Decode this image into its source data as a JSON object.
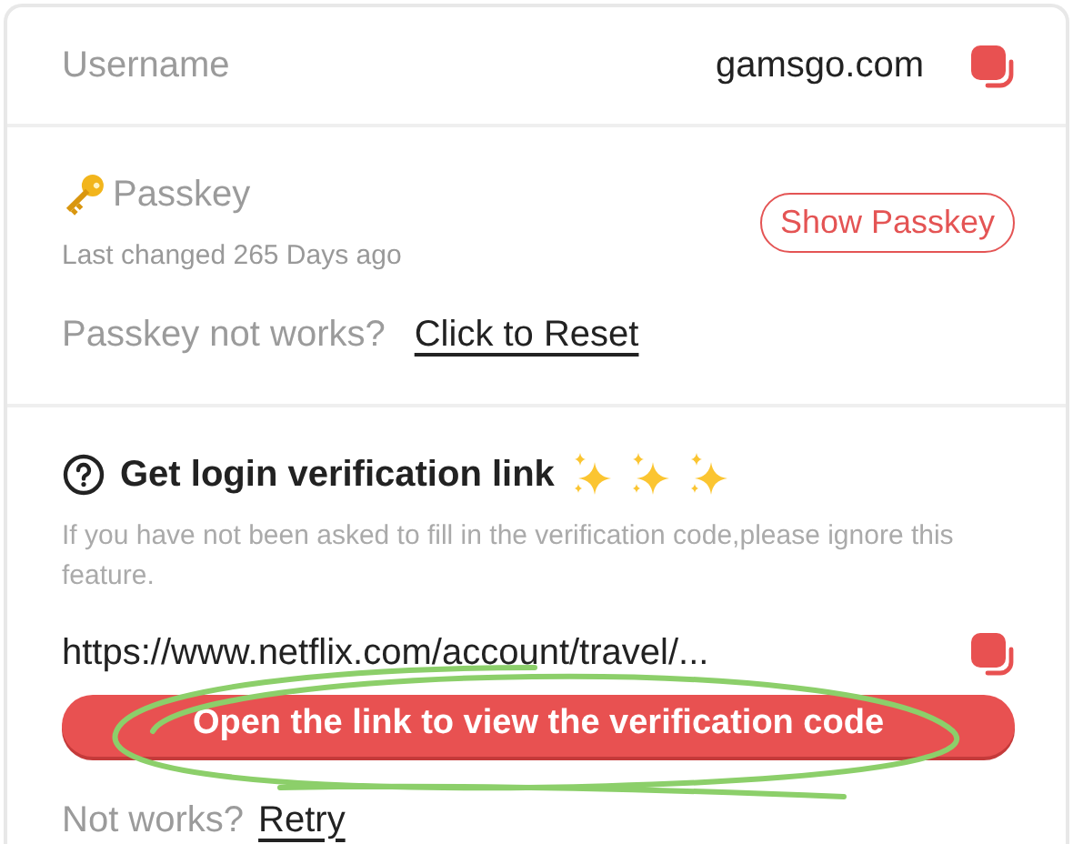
{
  "username": {
    "label": "Username",
    "value": "gamsgo.com"
  },
  "passkey": {
    "title": "Passkey",
    "last_changed": "Last changed 265 Days ago",
    "show_button": "Show Passkey",
    "reset_prompt": "Passkey not works?",
    "reset_link": "Click to Reset"
  },
  "verification": {
    "title": "Get login verification link",
    "description": "If you have not been asked to fill in the verification code,please ignore this feature.",
    "link": "https://www.netflix.com/account/travel/...",
    "open_button": "Open the link to view the verification code",
    "retry_prompt": "Not works?",
    "retry_link": "Retry"
  },
  "annotation": {
    "visible": true
  }
}
